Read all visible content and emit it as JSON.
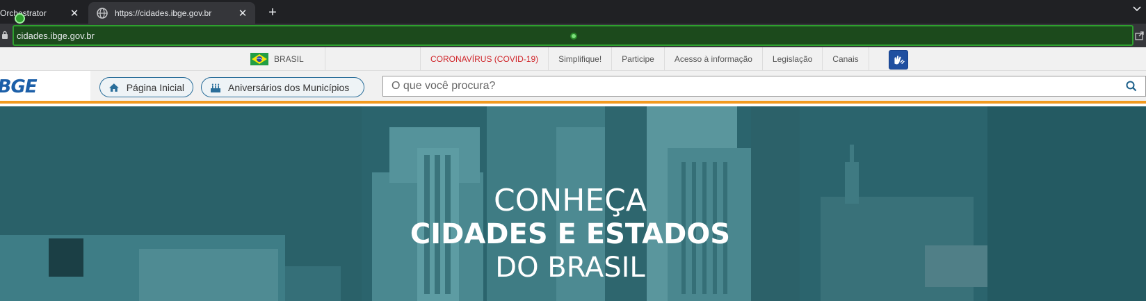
{
  "browser": {
    "tabs": [
      {
        "title": "Orchestrator",
        "active": false
      },
      {
        "title": "https://cidades.ibge.gov.br",
        "active": true
      }
    ],
    "new_tab_label": "+",
    "close_glyph": "✕",
    "address": "cidades.ibge.gov.br"
  },
  "govbar": {
    "country": "BRASIL",
    "links": [
      {
        "label": "CORONAVÍRUS (COVID-19)",
        "color": "#d0252a"
      },
      {
        "label": "Simplifique!"
      },
      {
        "label": "Participe"
      },
      {
        "label": "Acesso à informação"
      },
      {
        "label": "Legislação"
      },
      {
        "label": "Canais"
      }
    ]
  },
  "header": {
    "logo": "IBGE",
    "home_label": "Página Inicial",
    "anniversaries_label": "Aniversários dos Municípios",
    "search_placeholder": "O que você procura?"
  },
  "hero": {
    "line1": "CONHEÇA",
    "line2": "CIDADES E ESTADOS",
    "line3": "DO BRASIL"
  },
  "colors": {
    "accent_orange": "#f29a1f",
    "ibge_blue": "#1c5fa8",
    "hero_teal": "#2f6a73",
    "covid_red": "#d0252a"
  }
}
